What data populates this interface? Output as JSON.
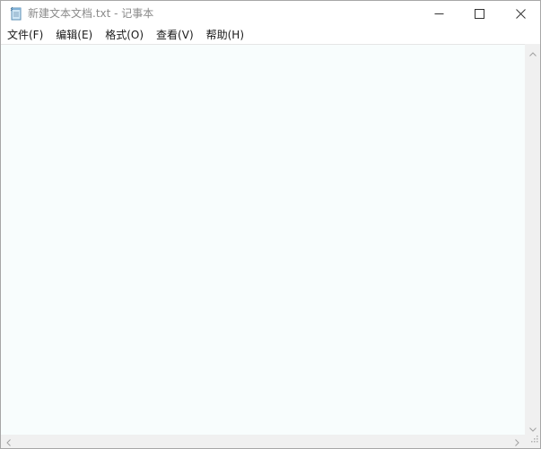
{
  "window": {
    "title": "新建文本文档.txt - 记事本",
    "app_icon": "notepad-icon",
    "controls": {
      "minimize_icon": "minimize-icon",
      "maximize_icon": "maximize-icon",
      "close_icon": "close-icon"
    }
  },
  "menubar": {
    "items": [
      {
        "label": "文件(F)"
      },
      {
        "label": "编辑(E)"
      },
      {
        "label": "格式(O)"
      },
      {
        "label": "查看(V)"
      },
      {
        "label": "帮助(H)"
      }
    ]
  },
  "editor": {
    "content": "",
    "background": "#f8fdfd"
  },
  "scrollbars": {
    "up_icon": "chevron-up-icon",
    "down_icon": "chevron-down-icon",
    "left_icon": "chevron-left-icon",
    "right_icon": "chevron-right-icon",
    "grip_icon": "size-grip-icon"
  }
}
